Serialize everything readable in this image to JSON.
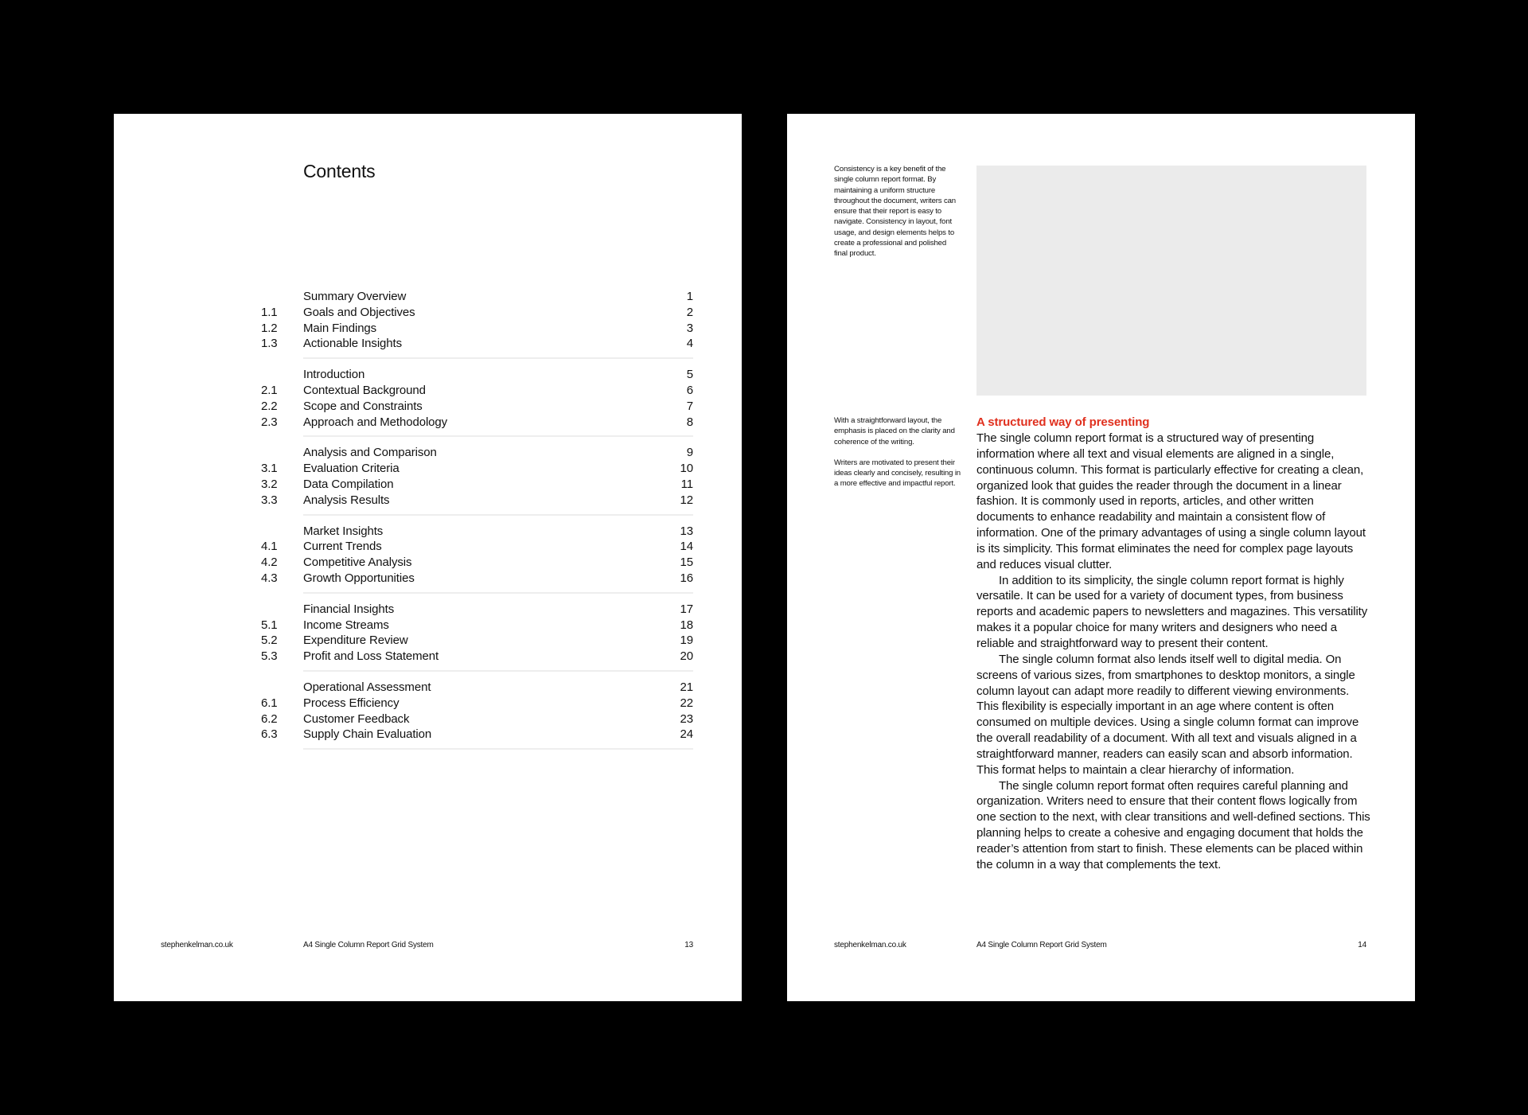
{
  "left_page": {
    "title": "Contents",
    "toc": [
      {
        "entries": [
          {
            "num": "",
            "title": "Summary Overview",
            "page": "1"
          },
          {
            "num": "1.1",
            "title": "Goals and Objectives",
            "page": "2"
          },
          {
            "num": "1.2",
            "title": "Main Findings",
            "page": "3"
          },
          {
            "num": "1.3",
            "title": "Actionable Insights",
            "page": "4"
          }
        ]
      },
      {
        "entries": [
          {
            "num": "",
            "title": "Introduction",
            "page": "5"
          },
          {
            "num": "2.1",
            "title": "Contextual Background",
            "page": "6"
          },
          {
            "num": "2.2",
            "title": "Scope and Constraints",
            "page": "7"
          },
          {
            "num": "2.3",
            "title": "Approach and Methodology",
            "page": "8"
          }
        ]
      },
      {
        "entries": [
          {
            "num": "",
            "title": "Analysis and Comparison",
            "page": "9"
          },
          {
            "num": "3.1",
            "title": "Evaluation Criteria",
            "page": "10"
          },
          {
            "num": "3.2",
            "title": "Data Compilation",
            "page": "11"
          },
          {
            "num": "3.3",
            "title": "Analysis Results",
            "page": "12"
          }
        ]
      },
      {
        "entries": [
          {
            "num": "",
            "title": "Market Insights",
            "page": "13"
          },
          {
            "num": "4.1",
            "title": "Current Trends",
            "page": "14"
          },
          {
            "num": "4.2",
            "title": "Competitive Analysis",
            "page": "15"
          },
          {
            "num": "4.3",
            "title": "Growth Opportunities",
            "page": "16"
          }
        ]
      },
      {
        "entries": [
          {
            "num": "",
            "title": "Financial Insights",
            "page": "17"
          },
          {
            "num": "5.1",
            "title": "Income Streams",
            "page": "18"
          },
          {
            "num": "5.2",
            "title": "Expenditure Review",
            "page": "19"
          },
          {
            "num": "5.3",
            "title": "Profit and Loss Statement",
            "page": "20"
          }
        ]
      },
      {
        "entries": [
          {
            "num": "",
            "title": "Operational Assessment",
            "page": "21"
          },
          {
            "num": "6.1",
            "title": "Process Efficiency",
            "page": "22"
          },
          {
            "num": "6.2",
            "title": "Customer Feedback",
            "page": "23"
          },
          {
            "num": "6.3",
            "title": "Supply Chain Evaluation",
            "page": "24"
          }
        ]
      }
    ],
    "footer": {
      "site": "stephenkelman.co.uk",
      "doc_title": "A4 Single Column Report Grid System",
      "page_number": "13"
    }
  },
  "right_page": {
    "side_note_1": "Consistency is a key benefit of the single column report format. By maintaining a uniform structure throughout the document, writers can ensure that their report is easy to navigate. Consistency in layout, font usage, and design elements helps to create a professional and polished final product.",
    "side_note_2": [
      "With a straightforward layout, the emphasis is placed on the clarity and coherence of the writing.",
      "Writers are motivated to present their ideas clearly and concisely, resulting in a more effective and impactful report."
    ],
    "image_placeholder_color": "#ebebeb",
    "heading": "A structured way of presenting",
    "heading_color": "#e0301e",
    "paragraphs": [
      "The single column report format is a structured way of presenting information where all text and visual elements are aligned in a single, continuous column. This format is particularly effective for creating a clean, organized look that guides the reader through the document in a linear fashion. It is commonly used in reports, articles, and other written documents to enhance readability and maintain a consistent flow of information. One of the primary advantages of using a single column layout is its simplicity. This format eliminates the need for complex page layouts and reduces visual clutter.",
      "In addition to its simplicity, the single column report format is highly versatile. It can be used for a variety of document types, from business reports and academic papers to newsletters and magazines. This versatility makes it a popular choice for many writers and designers who need a reliable and straightforward way to present their content.",
      "The single column format also lends itself well to digital media. On screens of various sizes, from smartphones to desktop monitors, a single column layout can adapt more readily to different viewing environments. This flexibility is especially important in an age where content is often consumed on multiple devices. Using a single column format can improve the overall readability of a document. With all text and visuals aligned in a straightforward manner, readers can easily scan and absorb information. This format helps to maintain a clear hierarchy of information.",
      "The single column report format often requires careful planning and organization. Writers need to ensure that their content flows logically from one section to the next, with clear transitions and well-defined sections. This planning helps to create a cohesive and engaging document that holds the reader’s attention from start to finish. These elements can be placed within the column in a way that complements the text."
    ],
    "footer": {
      "site": "stephenkelman.co.uk",
      "doc_title": "A4 Single Column Report Grid System",
      "page_number": "14"
    }
  }
}
